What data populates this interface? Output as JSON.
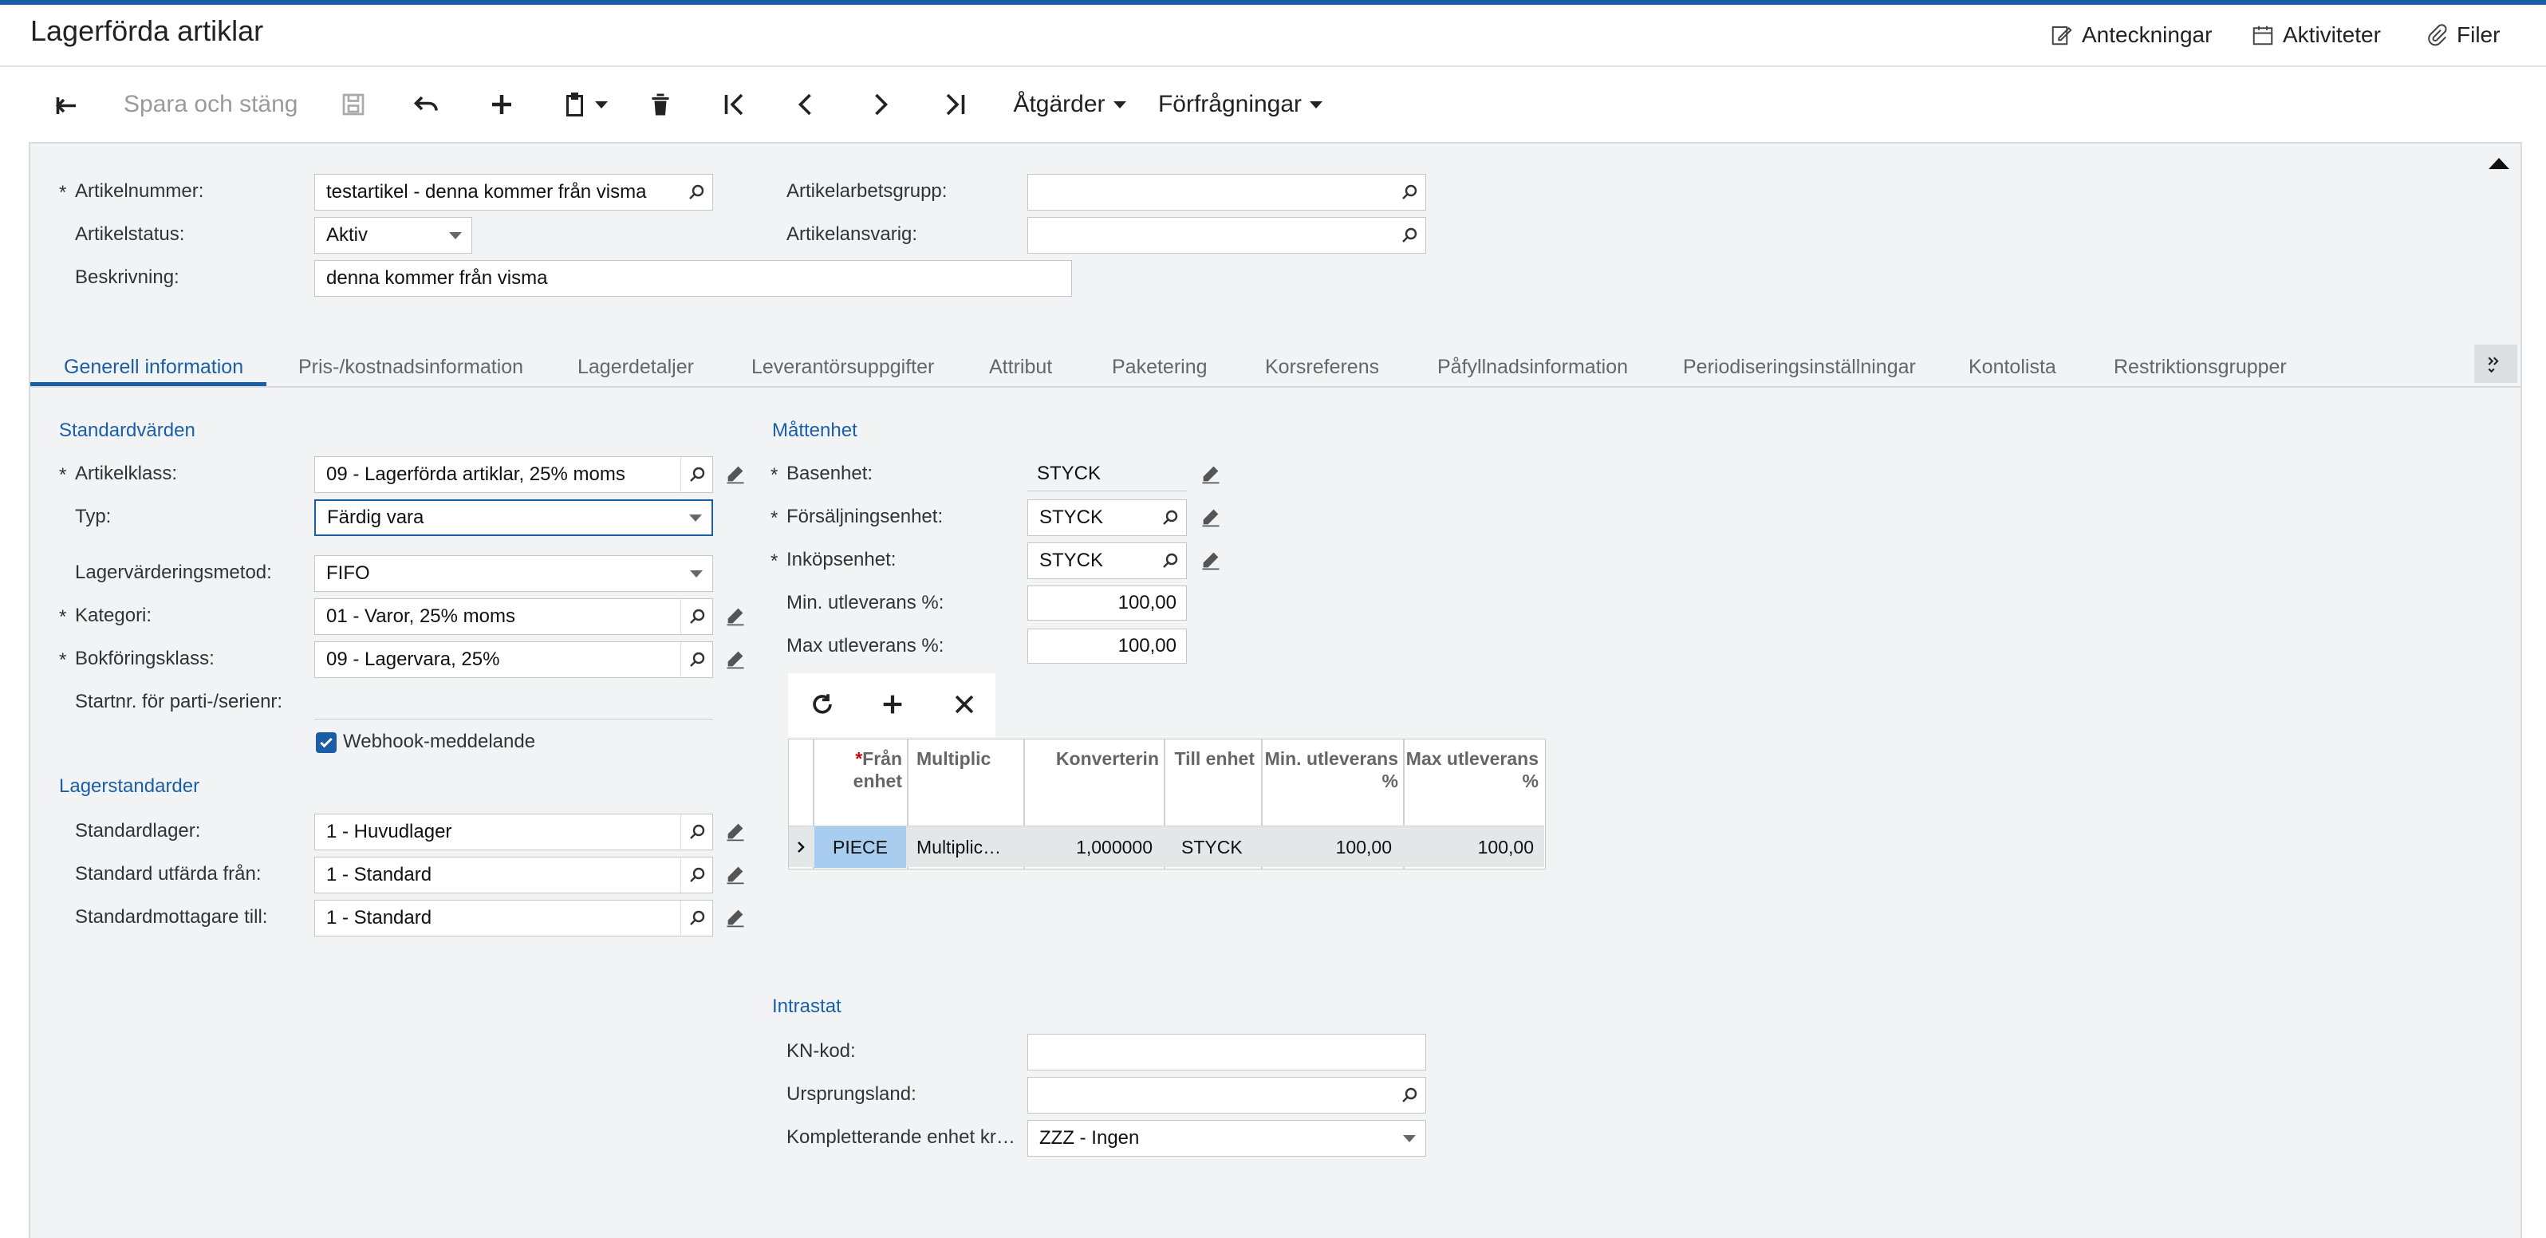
{
  "header": {
    "title": "Lagerförda artiklar",
    "notes_label": "Anteckningar",
    "activities_label": "Aktiviteter",
    "files_label": "Filer"
  },
  "toolbar": {
    "save_close_label": "Spara och stäng",
    "actions_label": "Åtgärder",
    "inquiries_label": "Förfrågningar"
  },
  "summary": {
    "item_number_label": "Artikelnummer:",
    "item_number_value": "testartikel - denna kommer från visma",
    "item_status_label": "Artikelstatus:",
    "item_status_value": "Aktiv",
    "description_label": "Beskrivning:",
    "description_value": "denna kommer från visma",
    "work_group_label": "Artikelarbetsgrupp:",
    "work_group_value": "",
    "manager_label": "Artikelansvarig:",
    "manager_value": ""
  },
  "tabs": [
    {
      "label": "Generell information",
      "active": true
    },
    {
      "label": "Pris-/kostnadsinformation"
    },
    {
      "label": "Lagerdetaljer"
    },
    {
      "label": "Leverantörsuppgifter"
    },
    {
      "label": "Attribut"
    },
    {
      "label": "Paketering"
    },
    {
      "label": "Korsreferens"
    },
    {
      "label": "Påfyllnadsinformation"
    },
    {
      "label": "Periodiseringsinställningar"
    },
    {
      "label": "Kontolista"
    },
    {
      "label": "Restriktionsgrupper"
    }
  ],
  "defaults": {
    "section_label": "Standardvärden",
    "item_class_label": "Artikelklass:",
    "item_class_value": "09 - Lagerförda artiklar, 25% moms",
    "type_label": "Typ:",
    "type_value": "Färdig vara",
    "valuation_label": "Lagervärderingsmetod:",
    "valuation_value": "FIFO",
    "category_label": "Kategori:",
    "category_value": "01 - Varor, 25% moms",
    "posting_class_label": "Bokföringsklass:",
    "posting_class_value": "09 - Lagervara, 25%",
    "lot_serial_label": "Startnr. för parti-/serienr:",
    "lot_serial_value": "",
    "webhook_label": "Webhook-meddelande",
    "webhook_checked": true
  },
  "warehouse": {
    "section_label": "Lagerstandarder",
    "default_warehouse_label": "Standardlager:",
    "default_warehouse_value": "1 - Huvudlager",
    "issue_from_label": "Standard utfärda från:",
    "issue_from_value": "1 - Standard",
    "receipt_to_label": "Standardmottagare till:",
    "receipt_to_value": "1 - Standard"
  },
  "uom": {
    "section_label": "Måttenhet",
    "base_unit_label": "Basenhet:",
    "base_unit_value": "STYCK",
    "sales_unit_label": "Försäljningsenhet:",
    "sales_unit_value": "STYCK",
    "purchase_unit_label": "Inköpsenhet:",
    "purchase_unit_value": "STYCK",
    "min_over_label": "Min. utleverans %:",
    "min_over_value": "100,00",
    "max_over_label": "Max utleverans %:",
    "max_over_value": "100,00"
  },
  "conversion_grid": {
    "columns": [
      "Från enhet",
      "Multiplic",
      "Konverterin",
      "Till enhet",
      "Min. utleverans %",
      "Max utleverans %"
    ],
    "rows": [
      {
        "from": "PIECE",
        "mult": "Multiplic…",
        "factor": "1,000000",
        "to": "STYCK",
        "min": "100,00",
        "max": "100,00"
      }
    ]
  },
  "intrastat": {
    "section_label": "Intrastat",
    "cn_code_label": "KN-kod:",
    "cn_code_value": "",
    "origin_label": "Ursprungsland:",
    "origin_value": "",
    "supp_unit_label": "Kompletterande enhet kr…",
    "supp_unit_value": "ZZZ - Ingen"
  }
}
